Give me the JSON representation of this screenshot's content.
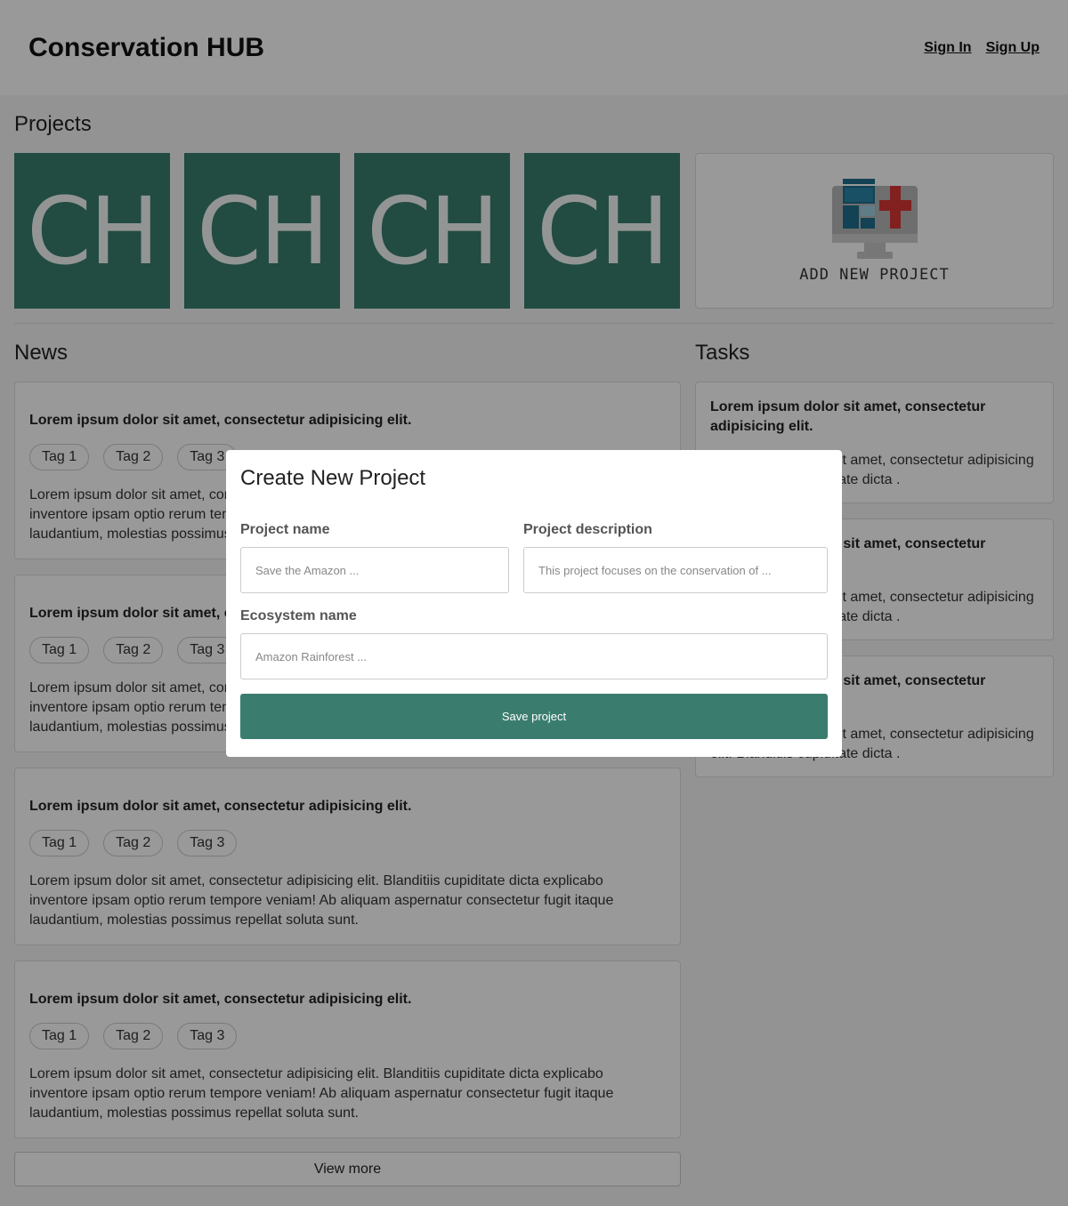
{
  "header": {
    "brand": "Conservation HUB",
    "sign_in": "Sign In",
    "sign_up": "Sign Up"
  },
  "projects": {
    "title": "Projects",
    "tiles": [
      "CH",
      "CH",
      "CH",
      "CH"
    ],
    "add_label": "ADD NEW PROJECT",
    "add_icon": "add-project-monitor-icon"
  },
  "news": {
    "title": "News",
    "items": [
      {
        "title": "Lorem ipsum dolor sit amet, consectetur adipisicing elit.",
        "tags": [
          "Tag 1",
          "Tag 2",
          "Tag 3"
        ],
        "body": "Lorem ipsum dolor sit amet, consectetur adipisicing elit. Blanditiis cupiditate dicta explicabo inventore ipsam optio rerum tempore veniam! Ab aliquam aspernatur consectetur fugit itaque laudantium, molestias possimus repellat soluta sunt."
      },
      {
        "title": "Lorem ipsum dolor sit amet, consectetur adipisicing elit.",
        "tags": [
          "Tag 1",
          "Tag 2",
          "Tag 3"
        ],
        "body": "Lorem ipsum dolor sit amet, consectetur adipisicing elit. Blanditiis cupiditate dicta explicabo inventore ipsam optio rerum tempore veniam! Ab aliquam aspernatur consectetur fugit itaque laudantium, molestias possimus repellat soluta sunt."
      },
      {
        "title": "Lorem ipsum dolor sit amet, consectetur adipisicing elit.",
        "tags": [
          "Tag 1",
          "Tag 2",
          "Tag 3"
        ],
        "body": "Lorem ipsum dolor sit amet, consectetur adipisicing elit. Blanditiis cupiditate dicta explicabo inventore ipsam optio rerum tempore veniam! Ab aliquam aspernatur consectetur fugit itaque laudantium, molestias possimus repellat soluta sunt."
      },
      {
        "title": "Lorem ipsum dolor sit amet, consectetur adipisicing elit.",
        "tags": [
          "Tag 1",
          "Tag 2",
          "Tag 3"
        ],
        "body": "Lorem ipsum dolor sit amet, consectetur adipisicing elit. Blanditiis cupiditate dicta explicabo inventore ipsam optio rerum tempore veniam! Ab aliquam aspernatur consectetur fugit itaque laudantium, molestias possimus repellat soluta sunt."
      }
    ],
    "view_more": "View more"
  },
  "tasks": {
    "title": "Tasks",
    "items": [
      {
        "title": "Lorem ipsum dolor sit amet, consectetur adipisicing elit.",
        "body": "Lorem ipsum dolor sit amet, consectetur adipisicing elit. Blanditiis cupiditate dicta ."
      },
      {
        "title": "Lorem ipsum dolor sit amet, consectetur adipisicing elit.",
        "body": "Lorem ipsum dolor sit amet, consectetur adipisicing elit. Blanditiis cupiditate dicta ."
      },
      {
        "title": "Lorem ipsum dolor sit amet, consectetur adipisicing elit.",
        "body": "Lorem ipsum dolor sit amet, consectetur adipisicing elit. Blanditiis cupiditate dicta ."
      }
    ]
  },
  "modal": {
    "title": "Create New Project",
    "project_name_label": "Project name",
    "project_name_placeholder": "Save the Amazon ...",
    "project_desc_label": "Project description",
    "project_desc_placeholder": "This project focuses on the conservation of ...",
    "ecosystem_label": "Ecosystem name",
    "ecosystem_placeholder": "Amazon Rainforest ...",
    "save_label": "Save project"
  },
  "colors": {
    "accent": "#3a7d6f",
    "overlay": "rgba(0,0,0,0.4)"
  }
}
